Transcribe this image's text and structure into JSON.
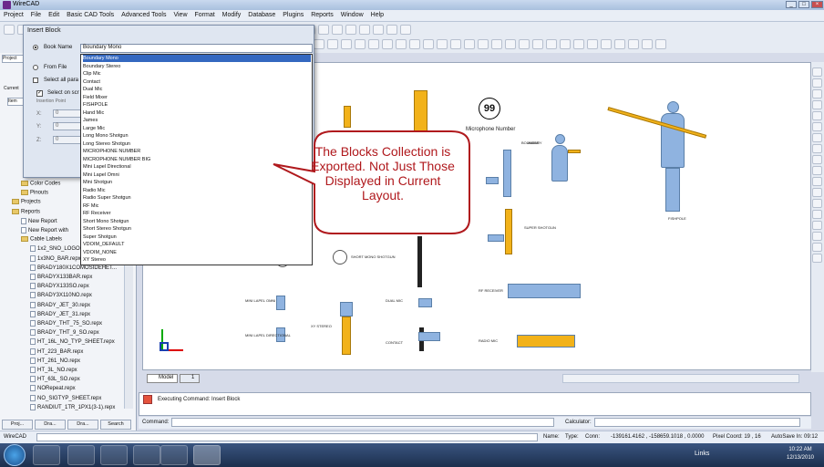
{
  "app": {
    "title": "WireCAD"
  },
  "menu": [
    "Project",
    "File",
    "Edit",
    "Basic CAD Tools",
    "Advanced Tools",
    "View",
    "Format",
    "Modify",
    "Database",
    "Plugins",
    "Reports",
    "Window",
    "Help"
  ],
  "dialog": {
    "title": "Insert Block",
    "book_name_label": "Book Name",
    "selected_book": "Boundary Mono",
    "from_file_label": "From File",
    "select_all_label": "Select all para",
    "select_on_screen_label": "Select on scr",
    "insertion_point_label": "Insertion Point",
    "x_label": "X:",
    "y_label": "Y:",
    "z_label": "Z:",
    "x_value": "0",
    "y_value": "0",
    "z_value": "0",
    "options": [
      "Boundary Mono",
      "Boundary Stereo",
      "Clip Mic",
      "Contact",
      "Dual Mic",
      "Field Mixer",
      "FISHPOLE",
      "Hand Mic",
      "James",
      "Large Mic",
      "Long Mono Shotgun",
      "Long Stereo Shotgun",
      "MICROPHONE NUMBER",
      "MICROPHONE NUMBER BIG",
      "Mini Lapel Directional",
      "Mini Lapel Omni",
      "Mini Shotgun",
      "Radio Mic",
      "Radio Super Shotgun",
      "RF Mic",
      "RF Receiver",
      "Short Mono Shotgun",
      "Short Stereo Shotgun",
      "Super Shotgun",
      "VDOIM_DEFAULT",
      "VDOIM_NONE",
      "XY Stereo"
    ]
  },
  "left_panel": {
    "tab_project": "Project",
    "label_current": "Current",
    "label_item": "Item",
    "tree": [
      {
        "label": "Color Codes",
        "type": "folder",
        "indent": 1
      },
      {
        "label": "Pinouts",
        "type": "folder",
        "indent": 1
      },
      {
        "label": "Projects",
        "type": "folder",
        "indent": 0
      },
      {
        "label": "Reports",
        "type": "folder",
        "indent": 0
      },
      {
        "label": "New Report",
        "type": "file",
        "indent": 1
      },
      {
        "label": "New Report with",
        "type": "file",
        "indent": 1
      },
      {
        "label": "Cable Labels",
        "type": "folder",
        "indent": 1
      },
      {
        "label": "1x2_SNO_LOGO.repx",
        "type": "file",
        "indent": 2
      },
      {
        "label": "1x3NO_BAR.repx",
        "type": "file",
        "indent": 2
      },
      {
        "label": "BRADY180X1COMOSIDEHET...",
        "type": "file",
        "indent": 2
      },
      {
        "label": "BRADYX133BAR.repx",
        "type": "file",
        "indent": 2
      },
      {
        "label": "BRADYX133SO.repx",
        "type": "file",
        "indent": 2
      },
      {
        "label": "BRADY3X110NO.repx",
        "type": "file",
        "indent": 2
      },
      {
        "label": "BRADY_JET_30.repx",
        "type": "file",
        "indent": 2
      },
      {
        "label": "BRADY_JET_31.repx",
        "type": "file",
        "indent": 2
      },
      {
        "label": "BRADY_THT_75_SO.repx",
        "type": "file",
        "indent": 2
      },
      {
        "label": "BRADY_THT_9_SO.repx",
        "type": "file",
        "indent": 2
      },
      {
        "label": "HT_16L_NO_TYP_SHEET.repx",
        "type": "file",
        "indent": 2
      },
      {
        "label": "HT_223_BAR.repx",
        "type": "file",
        "indent": 2
      },
      {
        "label": "HT_261_NO.repx",
        "type": "file",
        "indent": 2
      },
      {
        "label": "HT_3L_NO.repx",
        "type": "file",
        "indent": 2
      },
      {
        "label": "HT_63L_SO.repx",
        "type": "file",
        "indent": 2
      },
      {
        "label": "NORepeat.repx",
        "type": "file",
        "indent": 2
      },
      {
        "label": "NO_SIGTYP_SHEET.repx",
        "type": "file",
        "indent": 2
      },
      {
        "label": "RANDIUT_1TR_1PX1(3-1).repx",
        "type": "file",
        "indent": 2
      }
    ],
    "bottom_tabs": [
      "Proj...",
      "Dra...",
      "Dra...",
      "Search"
    ]
  },
  "canvas": {
    "mic_number": "99",
    "mic_number_label": "Microphone Number",
    "tab_model": "Model",
    "tab_layout": "1",
    "labels": {
      "jamea": "JAMES",
      "fishpole": "FISHPOLE",
      "boundary": "BOUNDARY",
      "super": "SUPER SHOTGUN",
      "short_mono": "SHORT MONO SHOTGUN",
      "dual": "DUAL MIC",
      "mini_lapel_omni": "MINI LAPEL OMNI",
      "mini_lapel_dir": "MINI LAPEL DIRECTIONAL",
      "xy": "XY STEREO",
      "contact": "CONTACT",
      "radio": "RF RECEIVER",
      "field": "RADIO MIC"
    }
  },
  "callout": "The Blocks Collection is Exported. Not Just Those Displayed in Current Layout.",
  "command": {
    "history": "Executing Command: Insert Block",
    "label": "Command:",
    "calculator_label": "Calculator:"
  },
  "status": {
    "app": "WireCAD",
    "name": "Name:",
    "type": "Type:",
    "conn": "Conn:",
    "coords": "-139161.4162 , -158659.1018 , 0.0000",
    "pixel": "Pixel Coord: 19 , 16",
    "autosave": "AutoSave In: 09:12"
  },
  "taskbar": {
    "links": "Links",
    "time": "10:22 AM",
    "date": "12/13/2010"
  },
  "colors": {
    "accent_red": "#b0191d",
    "mic_blue": "#8fb3e0",
    "mic_yellow": "#f2b21a"
  }
}
